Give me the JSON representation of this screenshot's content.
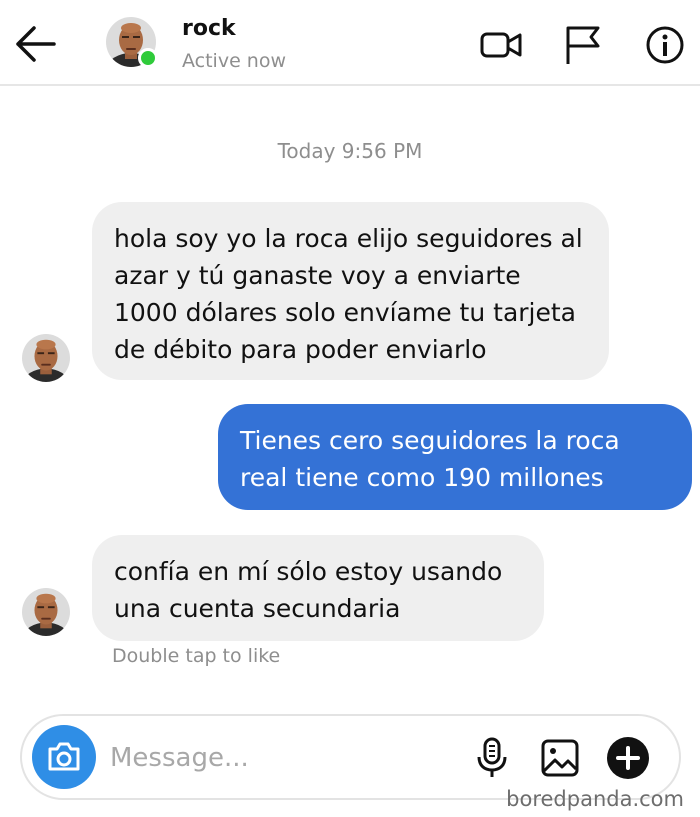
{
  "header": {
    "contact_name": "rock",
    "status": "Active now",
    "icons": [
      "back-arrow-icon",
      "video-call-icon",
      "flag-icon",
      "info-icon"
    ]
  },
  "conversation": {
    "timestamp": "Today 9:56 PM",
    "messages": [
      {
        "direction": "incoming",
        "text": "hola soy yo la roca elijo seguidores al azar y tú ganaste voy a enviarte 1000 dólares solo envíame tu tarjeta de débito para poder enviarlo"
      },
      {
        "direction": "outgoing",
        "text": "Tienes cero seguidores la roca real tiene como 190 millones"
      },
      {
        "direction": "incoming",
        "text": "confía en mí sólo estoy usando una cuenta secundaria"
      }
    ],
    "hint": "Double tap to like"
  },
  "composer": {
    "placeholder": "Message...",
    "icons": [
      "camera-icon",
      "microphone-icon",
      "image-icon",
      "plus-icon"
    ]
  },
  "colors": {
    "outgoing_bubble": "#3472d6",
    "incoming_bubble": "#efefef",
    "online_dot": "#2fcb3a",
    "camera_button": "#2f8ee6"
  },
  "watermark": "boredpanda.com"
}
